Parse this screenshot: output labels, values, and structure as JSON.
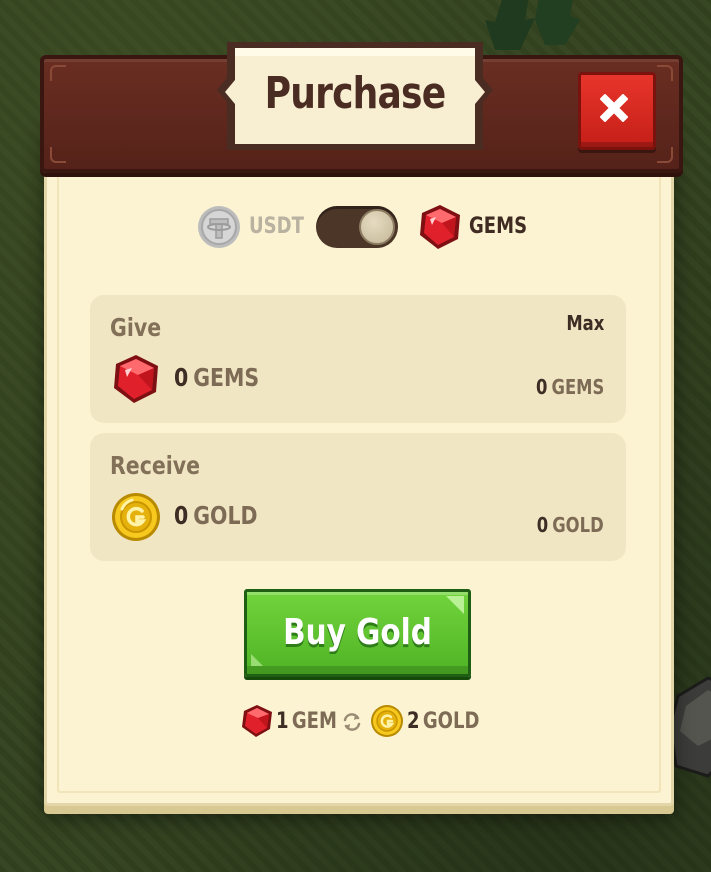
{
  "dialog": {
    "title": "Purchase",
    "close_icon": "close-x-icon"
  },
  "currency_toggle": {
    "left_label": "USDT",
    "right_label": "GEMS",
    "selected": "GEMS",
    "left_icon": "usdt-coin-icon",
    "right_icon": "gem-icon"
  },
  "give": {
    "label": "Give",
    "max_label": "Max",
    "amount": "0",
    "unit": "GEMS",
    "balance": "0",
    "balance_unit": "GEMS",
    "icon": "gem-icon"
  },
  "receive": {
    "label": "Receive",
    "amount": "0",
    "unit": "GOLD",
    "balance": "0",
    "balance_unit": "GOLD",
    "icon": "gold-coin-icon"
  },
  "buy_button": {
    "label": "Buy Gold"
  },
  "rate": {
    "from_amount": "1",
    "from_unit": "GEM",
    "to_amount": "2",
    "to_unit": "GOLD",
    "swap_icon": "swap-arrows-icon"
  },
  "colors": {
    "panel_bg": "#fbf3d2",
    "header_bg": "#5e271c",
    "close_red": "#d62a22",
    "buy_green": "#5fc32f",
    "text_dark": "#3d2d24",
    "text_muted": "#7d6b55"
  }
}
